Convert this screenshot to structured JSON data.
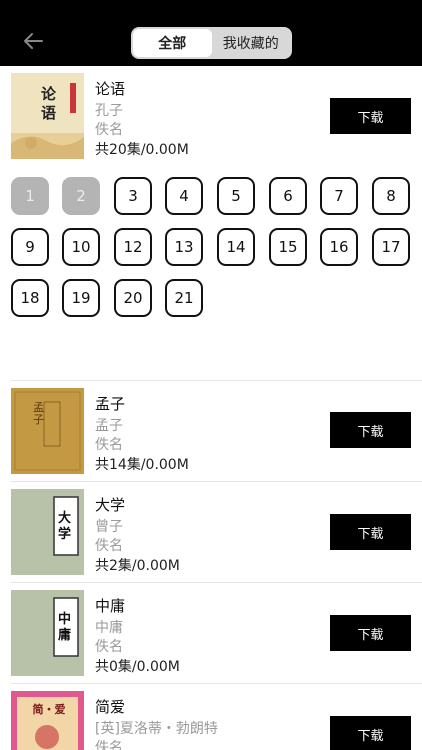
{
  "tabs": {
    "all": "全部",
    "favorites": "我收藏的"
  },
  "books": [
    {
      "title": "论语",
      "author": "孔子",
      "reader": "佚名",
      "count": "共20集/0.00M",
      "button": "下载",
      "cover_text": "论语"
    },
    {
      "title": "孟子",
      "author": "孟子",
      "reader": "佚名",
      "count": "共14集/0.00M",
      "button": "下载",
      "cover_text": "孟子"
    },
    {
      "title": "大学",
      "author": "曾子",
      "reader": "佚名",
      "count": "共2集/0.00M",
      "button": "下载",
      "cover_text": "大学"
    },
    {
      "title": "中庸",
      "author": "中庸",
      "reader": "佚名",
      "count": "共0集/0.00M",
      "button": "下载",
      "cover_text": "中庸"
    },
    {
      "title": "简爱",
      "author": "[英]夏洛蒂・勃朗特",
      "reader": "佚名",
      "button": "下载",
      "cover_text": "简・爱"
    }
  ],
  "episodes": [
    "1",
    "2",
    "3",
    "4",
    "5",
    "6",
    "7",
    "8",
    "9",
    "10",
    "12",
    "13",
    "14",
    "15",
    "16",
    "17",
    "18",
    "19",
    "20",
    "21"
  ],
  "downloaded": [
    "1",
    "2"
  ],
  "colors": {
    "topbar": "#000000",
    "button": "#000000",
    "downloaded_chip": "#b4b4b4"
  }
}
